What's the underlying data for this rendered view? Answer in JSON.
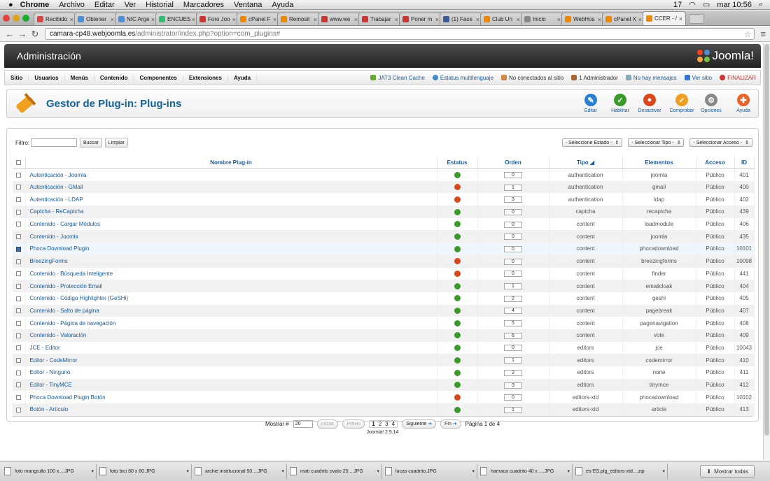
{
  "macmenu": {
    "app": "Chrome",
    "items": [
      "Archivo",
      "Editar",
      "Ver",
      "Historial",
      "Marcadores",
      "Ventana",
      "Ayuda"
    ],
    "status_count": "17",
    "clock": "mar 10:56"
  },
  "tabs": [
    {
      "label": "Recibido",
      "color": "#d44"
    },
    {
      "label": "Obtener",
      "color": "#4a90d9"
    },
    {
      "label": "NIC Arge",
      "color": "#4a90d9"
    },
    {
      "label": "ENCUES",
      "color": "#3b7"
    },
    {
      "label": "Foro Joo",
      "color": "#c33"
    },
    {
      "label": "cPanel F",
      "color": "#e80"
    },
    {
      "label": "Remosit",
      "color": "#e80"
    },
    {
      "label": "www.we",
      "color": "#c33"
    },
    {
      "label": "Trabajar",
      "color": "#c33"
    },
    {
      "label": "Poner m",
      "color": "#c33"
    },
    {
      "label": "(1) Face",
      "color": "#3b5998"
    },
    {
      "label": "Club Un",
      "color": "#e80"
    },
    {
      "label": "Inicio",
      "color": "#888"
    },
    {
      "label": "WebHos",
      "color": "#e80"
    },
    {
      "label": "cPanel X",
      "color": "#e80"
    },
    {
      "label": "CCER - /",
      "color": "#e80"
    }
  ],
  "url": {
    "host": "camara-cp48.webjoomla.es",
    "path": "/administrator/index.php?option=com_plugins#"
  },
  "admin": {
    "title": "Administración",
    "logo": "Joomla!"
  },
  "menu": [
    "Sitio",
    "Usuarios",
    "Menús",
    "Contenido",
    "Componentes",
    "Extensiones",
    "Ayuda"
  ],
  "status": {
    "cache": "JAT3 Clean Cache",
    "multilang": "Estatus multilenguaje",
    "visitors": "No conectados al sitio",
    "admins": "1 Administrador",
    "messages": "No hay mensajes",
    "view_site": "Ver sitio",
    "logout": "FINALIZAR"
  },
  "page_title": "Gestor de Plug-in: Plug-ins",
  "toolbar": [
    {
      "label": "Editar",
      "icon": "edit-icon",
      "color": "#2a7fd0",
      "glyph": "✎"
    },
    {
      "label": "Habilitar",
      "icon": "check-icon",
      "color": "#3c9a2d",
      "glyph": "✓"
    },
    {
      "label": "Desactivar",
      "icon": "stop-icon",
      "color": "#d9481c",
      "glyph": "●"
    },
    {
      "label": "Comprobar",
      "icon": "checkin-icon",
      "color": "#f0a020",
      "glyph": "✓"
    },
    {
      "label": "Opciones",
      "icon": "options-icon",
      "color": "#888888",
      "glyph": "⚙"
    },
    {
      "label": "Ayuda",
      "icon": "help-icon",
      "color": "#e8632a",
      "glyph": "✚"
    }
  ],
  "filter": {
    "label": "Filtro:",
    "value": "",
    "search": "Buscar",
    "clear": "Limpiar"
  },
  "selects": [
    "- Seleccione Estado -",
    "- Seleccionar Tipo -",
    "- Seleccionar Acceso -"
  ],
  "columns": {
    "name": "Nombre Plug-in",
    "status": "Estatus",
    "order": "Orden",
    "type": "Tipo",
    "element": "Elementos",
    "access": "Acceso",
    "id": "ID"
  },
  "rows": [
    {
      "name": "Autenticación - Joomla",
      "enabled": true,
      "order": "0",
      "type": "authentication",
      "element": "joomla",
      "access": "Público",
      "id": "401",
      "checked": false
    },
    {
      "name": "Autenticación - GMail",
      "enabled": false,
      "order": "1",
      "type": "authentication",
      "element": "gmail",
      "access": "Público",
      "id": "400",
      "checked": false
    },
    {
      "name": "Autenticación - LDAP",
      "enabled": false,
      "order": "3",
      "type": "authentication",
      "element": "ldap",
      "access": "Público",
      "id": "402",
      "checked": false
    },
    {
      "name": "Captcha - ReCaptcha",
      "enabled": true,
      "order": "0",
      "type": "captcha",
      "element": "recaptcha",
      "access": "Público",
      "id": "439",
      "checked": false
    },
    {
      "name": "Contenido - Cargar Módulos",
      "enabled": true,
      "order": "0",
      "type": "content",
      "element": "loadmodule",
      "access": "Público",
      "id": "406",
      "checked": false
    },
    {
      "name": "Contenido - Joomla",
      "enabled": true,
      "order": "0",
      "type": "content",
      "element": "joomla",
      "access": "Público",
      "id": "435",
      "checked": false
    },
    {
      "name": "Phoca Download Plugin",
      "enabled": true,
      "order": "0",
      "type": "content",
      "element": "phocadownload",
      "access": "Público",
      "id": "10101",
      "checked": true
    },
    {
      "name": "BreezingForms",
      "enabled": false,
      "order": "0",
      "type": "content",
      "element": "breezingforms",
      "access": "Público",
      "id": "10098",
      "checked": false
    },
    {
      "name": "Contenido - Búsqueda Inteligente",
      "enabled": false,
      "order": "0",
      "type": "content",
      "element": "finder",
      "access": "Público",
      "id": "441",
      "checked": false
    },
    {
      "name": "Contenido - Protección Email",
      "enabled": true,
      "order": "1",
      "type": "content",
      "element": "emailcloak",
      "access": "Público",
      "id": "404",
      "checked": false
    },
    {
      "name": "Contenido - Código Highlighter (GeSHi)",
      "enabled": true,
      "order": "2",
      "type": "content",
      "element": "geshi",
      "access": "Público",
      "id": "405",
      "checked": false
    },
    {
      "name": "Contenido - Salto de página",
      "enabled": true,
      "order": "4",
      "type": "content",
      "element": "pagebreak",
      "access": "Público",
      "id": "407",
      "checked": false
    },
    {
      "name": "Contenido - Página de navegación",
      "enabled": true,
      "order": "5",
      "type": "content",
      "element": "pagenavigation",
      "access": "Público",
      "id": "408",
      "checked": false
    },
    {
      "name": "Contenido - Valoración",
      "enabled": true,
      "order": "6",
      "type": "content",
      "element": "vote",
      "access": "Público",
      "id": "409",
      "checked": false
    },
    {
      "name": "JCE - Editor",
      "enabled": true,
      "order": "0",
      "type": "editors",
      "element": "jce",
      "access": "Público",
      "id": "10043",
      "checked": false
    },
    {
      "name": "Editor - CodeMirror",
      "enabled": true,
      "order": "1",
      "type": "editors",
      "element": "codemirror",
      "access": "Público",
      "id": "410",
      "checked": false
    },
    {
      "name": "Editor - Ninguno",
      "enabled": true,
      "order": "2",
      "type": "editors",
      "element": "none",
      "access": "Público",
      "id": "411",
      "checked": false
    },
    {
      "name": "Editor - TinyMCE",
      "enabled": true,
      "order": "3",
      "type": "editors",
      "element": "tinymce",
      "access": "Público",
      "id": "412",
      "checked": false
    },
    {
      "name": "Phoca Download Plugin Botón",
      "enabled": false,
      "order": "0",
      "type": "editors-xtd",
      "element": "phocadownload",
      "access": "Público",
      "id": "10102",
      "checked": false
    },
    {
      "name": "Botón - Artículo",
      "enabled": true,
      "order": "1",
      "type": "editors-xtd",
      "element": "article",
      "access": "Público",
      "id": "413",
      "checked": false
    }
  ],
  "pagination": {
    "show_label": "Mostrar #",
    "limit": "20",
    "start": "Iniciar",
    "prev": "Previo",
    "pages": [
      "1",
      "2",
      "3",
      "4"
    ],
    "next": "Siguiente",
    "end": "Fin",
    "info": "Página 1 de 4"
  },
  "footer": "Joomla! 2.5.14",
  "downloads": [
    "foto mangrullo 100 x....JPG",
    "foto bici 80 x 80.JPG",
    "archie institucional 50....JPG",
    "mati cuadrito ovalo 25....JPG",
    "lucas cuadrito.JPG",
    "hamaca cuadrito 40 x ....JPG",
    "es-ES.plg_editors-xtd....zip"
  ],
  "show_all": "Mostrar todas",
  "colors": {
    "link": "#1b5a96",
    "enabled": "#3c9a2d",
    "disabled": "#d9481c",
    "header": "#2b2b2b"
  }
}
